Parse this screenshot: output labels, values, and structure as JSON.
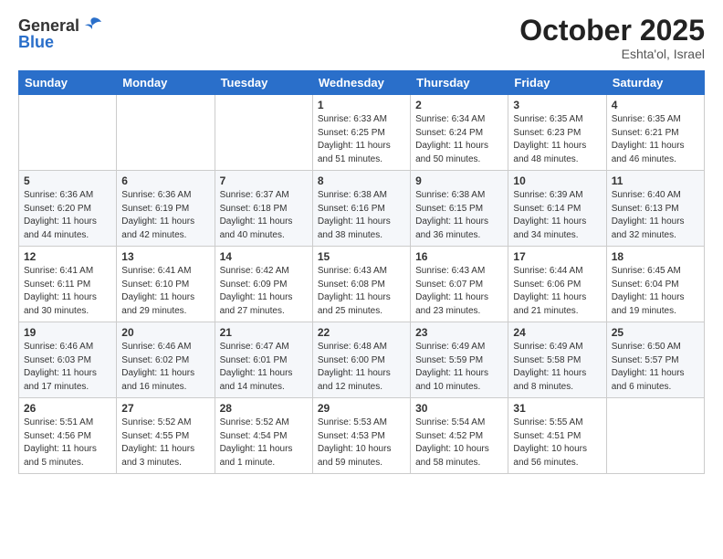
{
  "header": {
    "logo_line1": "General",
    "logo_line2": "Blue",
    "month": "October 2025",
    "location": "Eshta'ol, Israel"
  },
  "days_of_week": [
    "Sunday",
    "Monday",
    "Tuesday",
    "Wednesday",
    "Thursday",
    "Friday",
    "Saturday"
  ],
  "weeks": [
    [
      {
        "day": "",
        "info": ""
      },
      {
        "day": "",
        "info": ""
      },
      {
        "day": "",
        "info": ""
      },
      {
        "day": "1",
        "info": "Sunrise: 6:33 AM\nSunset: 6:25 PM\nDaylight: 11 hours\nand 51 minutes."
      },
      {
        "day": "2",
        "info": "Sunrise: 6:34 AM\nSunset: 6:24 PM\nDaylight: 11 hours\nand 50 minutes."
      },
      {
        "day": "3",
        "info": "Sunrise: 6:35 AM\nSunset: 6:23 PM\nDaylight: 11 hours\nand 48 minutes."
      },
      {
        "day": "4",
        "info": "Sunrise: 6:35 AM\nSunset: 6:21 PM\nDaylight: 11 hours\nand 46 minutes."
      }
    ],
    [
      {
        "day": "5",
        "info": "Sunrise: 6:36 AM\nSunset: 6:20 PM\nDaylight: 11 hours\nand 44 minutes."
      },
      {
        "day": "6",
        "info": "Sunrise: 6:36 AM\nSunset: 6:19 PM\nDaylight: 11 hours\nand 42 minutes."
      },
      {
        "day": "7",
        "info": "Sunrise: 6:37 AM\nSunset: 6:18 PM\nDaylight: 11 hours\nand 40 minutes."
      },
      {
        "day": "8",
        "info": "Sunrise: 6:38 AM\nSunset: 6:16 PM\nDaylight: 11 hours\nand 38 minutes."
      },
      {
        "day": "9",
        "info": "Sunrise: 6:38 AM\nSunset: 6:15 PM\nDaylight: 11 hours\nand 36 minutes."
      },
      {
        "day": "10",
        "info": "Sunrise: 6:39 AM\nSunset: 6:14 PM\nDaylight: 11 hours\nand 34 minutes."
      },
      {
        "day": "11",
        "info": "Sunrise: 6:40 AM\nSunset: 6:13 PM\nDaylight: 11 hours\nand 32 minutes."
      }
    ],
    [
      {
        "day": "12",
        "info": "Sunrise: 6:41 AM\nSunset: 6:11 PM\nDaylight: 11 hours\nand 30 minutes."
      },
      {
        "day": "13",
        "info": "Sunrise: 6:41 AM\nSunset: 6:10 PM\nDaylight: 11 hours\nand 29 minutes."
      },
      {
        "day": "14",
        "info": "Sunrise: 6:42 AM\nSunset: 6:09 PM\nDaylight: 11 hours\nand 27 minutes."
      },
      {
        "day": "15",
        "info": "Sunrise: 6:43 AM\nSunset: 6:08 PM\nDaylight: 11 hours\nand 25 minutes."
      },
      {
        "day": "16",
        "info": "Sunrise: 6:43 AM\nSunset: 6:07 PM\nDaylight: 11 hours\nand 23 minutes."
      },
      {
        "day": "17",
        "info": "Sunrise: 6:44 AM\nSunset: 6:06 PM\nDaylight: 11 hours\nand 21 minutes."
      },
      {
        "day": "18",
        "info": "Sunrise: 6:45 AM\nSunset: 6:04 PM\nDaylight: 11 hours\nand 19 minutes."
      }
    ],
    [
      {
        "day": "19",
        "info": "Sunrise: 6:46 AM\nSunset: 6:03 PM\nDaylight: 11 hours\nand 17 minutes."
      },
      {
        "day": "20",
        "info": "Sunrise: 6:46 AM\nSunset: 6:02 PM\nDaylight: 11 hours\nand 16 minutes."
      },
      {
        "day": "21",
        "info": "Sunrise: 6:47 AM\nSunset: 6:01 PM\nDaylight: 11 hours\nand 14 minutes."
      },
      {
        "day": "22",
        "info": "Sunrise: 6:48 AM\nSunset: 6:00 PM\nDaylight: 11 hours\nand 12 minutes."
      },
      {
        "day": "23",
        "info": "Sunrise: 6:49 AM\nSunset: 5:59 PM\nDaylight: 11 hours\nand 10 minutes."
      },
      {
        "day": "24",
        "info": "Sunrise: 6:49 AM\nSunset: 5:58 PM\nDaylight: 11 hours\nand 8 minutes."
      },
      {
        "day": "25",
        "info": "Sunrise: 6:50 AM\nSunset: 5:57 PM\nDaylight: 11 hours\nand 6 minutes."
      }
    ],
    [
      {
        "day": "26",
        "info": "Sunrise: 5:51 AM\nSunset: 4:56 PM\nDaylight: 11 hours\nand 5 minutes."
      },
      {
        "day": "27",
        "info": "Sunrise: 5:52 AM\nSunset: 4:55 PM\nDaylight: 11 hours\nand 3 minutes."
      },
      {
        "day": "28",
        "info": "Sunrise: 5:52 AM\nSunset: 4:54 PM\nDaylight: 11 hours\nand 1 minute."
      },
      {
        "day": "29",
        "info": "Sunrise: 5:53 AM\nSunset: 4:53 PM\nDaylight: 10 hours\nand 59 minutes."
      },
      {
        "day": "30",
        "info": "Sunrise: 5:54 AM\nSunset: 4:52 PM\nDaylight: 10 hours\nand 58 minutes."
      },
      {
        "day": "31",
        "info": "Sunrise: 5:55 AM\nSunset: 4:51 PM\nDaylight: 10 hours\nand 56 minutes."
      },
      {
        "day": "",
        "info": ""
      }
    ]
  ]
}
